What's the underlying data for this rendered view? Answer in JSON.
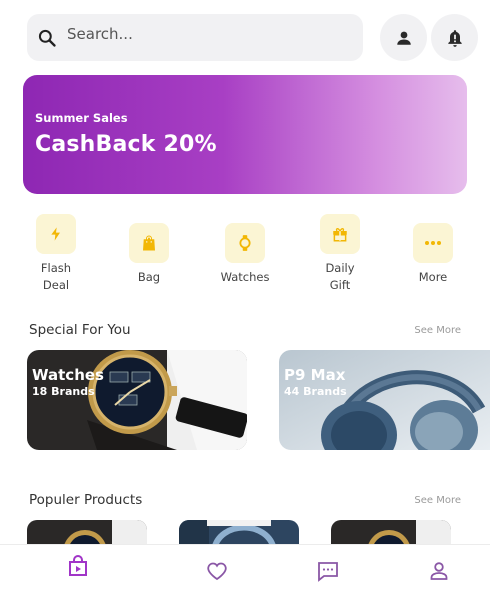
{
  "search": {
    "placeholder": "Search..."
  },
  "icons": {
    "search": "search-icon",
    "user": "person-icon",
    "bell": "notification-alert-icon"
  },
  "banner": {
    "subtitle": "Summer Sales",
    "headline": "CashBack 20%",
    "gradient_colors": [
      "#8e27b3",
      "#a83fc4",
      "#d58fe0",
      "#e6bdec"
    ]
  },
  "categories": [
    {
      "label": "Flash\nDeal",
      "icon": "flash-icon"
    },
    {
      "label": "Bag",
      "icon": "bag-icon"
    },
    {
      "label": "Watches",
      "icon": "watch-icon"
    },
    {
      "label": "Daily\nGift",
      "icon": "gift-icon"
    },
    {
      "label": "More",
      "icon": "more-dots-icon"
    }
  ],
  "special": {
    "title": "Special For You",
    "see_more": "See More",
    "cards": [
      {
        "title": "Watches",
        "count": "18 Brands"
      },
      {
        "title": "P9 Max",
        "count": "44 Brands"
      }
    ]
  },
  "popular": {
    "title": "Populer Products",
    "see_more": "See More"
  },
  "nav": [
    {
      "icon": "shop-icon",
      "active": true
    },
    {
      "icon": "heart-icon",
      "active": false
    },
    {
      "icon": "chat-icon",
      "active": false
    },
    {
      "icon": "profile-icon",
      "active": false
    }
  ],
  "colors": {
    "accent": "#a135c8",
    "category_bg": "#fbf5d4",
    "category_icon": "#f2b705",
    "nav_icon": "#8a57a6"
  }
}
